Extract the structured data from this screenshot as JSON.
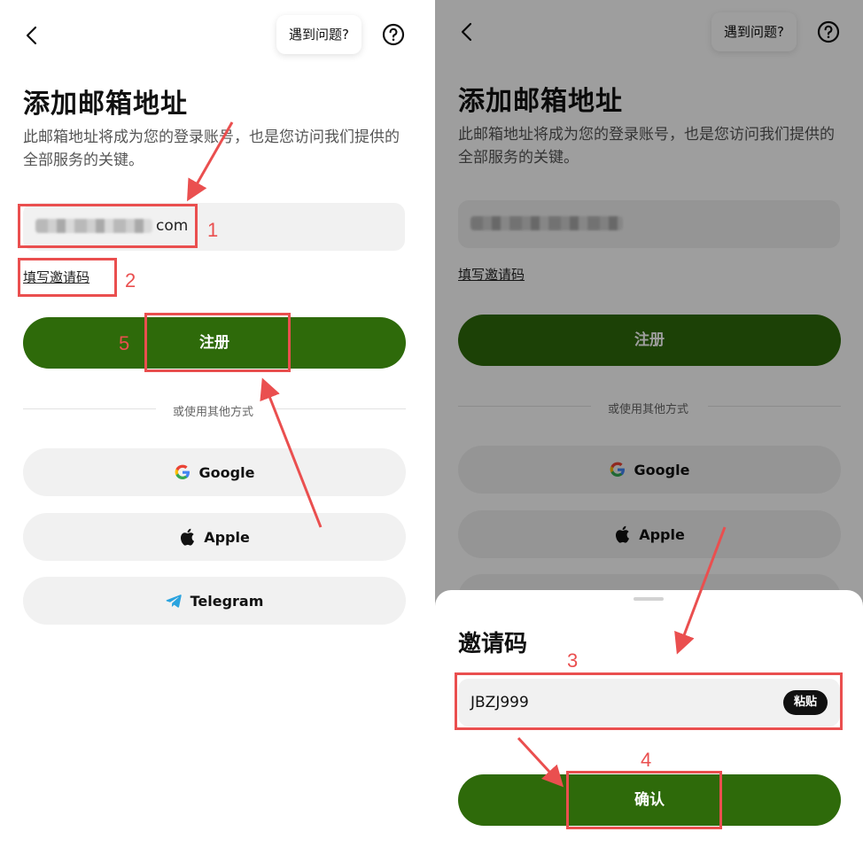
{
  "left": {
    "help_label": "遇到问题?",
    "title": "添加邮箱地址",
    "subtitle": "此邮箱地址将成为您的登录账号，也是您访问我们提供的全部服务的关键。",
    "email_visible_suffix": "com",
    "invite_link": "填写邀请码",
    "register_button": "注册",
    "divider_text": "或使用其他方式",
    "oauth": [
      {
        "label": "Google",
        "icon": "google-icon"
      },
      {
        "label": "Apple",
        "icon": "apple-icon"
      },
      {
        "label": "Telegram",
        "icon": "telegram-icon"
      }
    ]
  },
  "right": {
    "help_label": "遇到问题?",
    "title": "添加邮箱地址",
    "subtitle": "此邮箱地址将成为您的登录账号，也是您访问我们提供的全部服务的关键。",
    "invite_link": "填写邀请码",
    "register_button": "注册",
    "divider_text": "或使用其他方式",
    "oauth": [
      {
        "label": "Google",
        "icon": "google-icon"
      },
      {
        "label": "Apple",
        "icon": "apple-icon"
      }
    ],
    "sheet": {
      "title": "邀请码",
      "invite_code": "JBZJ999",
      "paste_button": "粘贴",
      "confirm_button": "确认"
    }
  },
  "annotations": [
    "1",
    "2",
    "3",
    "4",
    "5"
  ],
  "colors": {
    "primary": "#2e6a0a",
    "annotation": "#ea4f4f",
    "field_bg": "#f1f1f1"
  }
}
